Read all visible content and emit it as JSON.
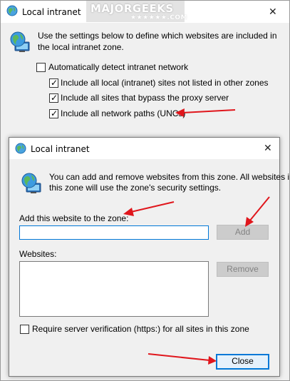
{
  "back_dialog": {
    "title": "Local intranet",
    "close_glyph": "✕",
    "watermark_main": "MAJORGEEKS",
    "watermark_sub": "★★★★★★.COM",
    "description": [
      "Use the settings below to define which websites are included in",
      "the local intranet zone."
    ],
    "auto_detect": {
      "label": "Automatically detect intranet network",
      "checked": false
    },
    "options": [
      {
        "label": "Include all local (intranet) sites not listed in other zones",
        "checked": true
      },
      {
        "label": "Include all sites that bypass the proxy server",
        "checked": true
      },
      {
        "label": "Include all network paths (UNCs)",
        "checked": true
      }
    ]
  },
  "front_dialog": {
    "title": "Local intranet",
    "close_glyph": "✕",
    "description": [
      "You can add and remove websites from this zone. All websites in",
      "this zone will use the zone's security settings."
    ],
    "add_label": "Add this website to the zone:",
    "add_input_value": "",
    "add_button": "Add",
    "websites_label": "Websites:",
    "websites": [],
    "remove_button": "Remove",
    "require_verification": {
      "label": "Require server verification (https:) for all sites in this zone",
      "checked": false
    },
    "close_button": "Close"
  },
  "check_glyph": "✓",
  "colors": {
    "accent": "#0078d7",
    "arrow": "#e0161c",
    "dialog_bg": "#f0f0f0"
  },
  "icons": [
    "globe-computer-icon",
    "checkbox-icon",
    "close-icon",
    "arrow-annotation"
  ]
}
